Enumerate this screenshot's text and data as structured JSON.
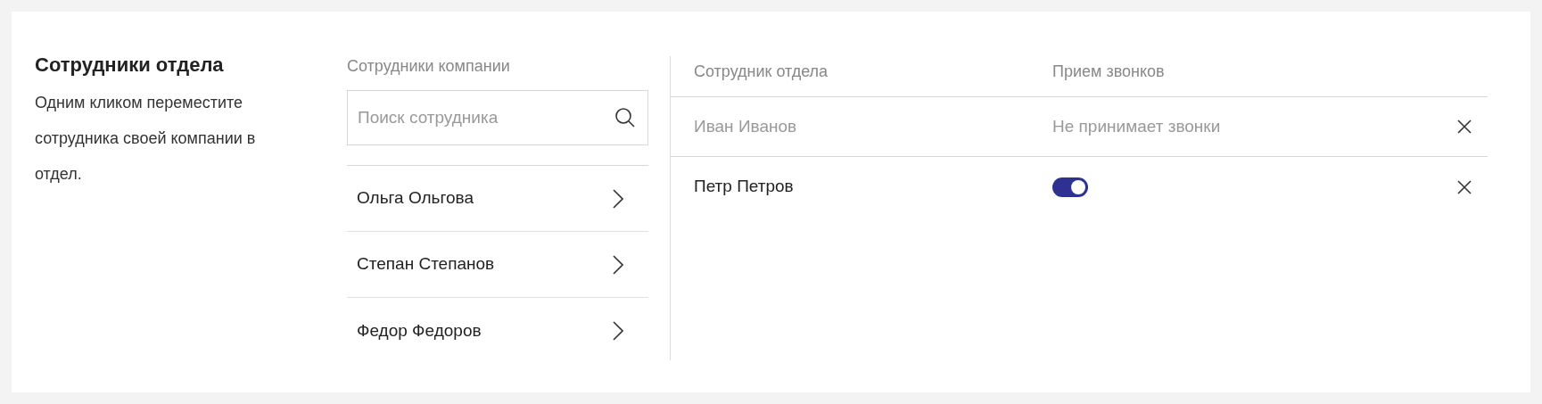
{
  "intro": {
    "title": "Сотрудники отдела",
    "description": "Одним кликом переместите сотрудника своей компании в отдел."
  },
  "company": {
    "header": "Сотрудники компании",
    "search": {
      "placeholder": "Поиск сотрудника"
    },
    "employees": [
      {
        "name": "Ольга Ольгова"
      },
      {
        "name": "Степан Степанов"
      },
      {
        "name": "Федор Федоров"
      }
    ]
  },
  "department": {
    "columns": [
      "Сотрудник отдела",
      "Прием звонков"
    ],
    "rows": [
      {
        "name": "Иван Иванов",
        "kind": "status",
        "status": "Не принимает звонки",
        "disabled": true
      },
      {
        "name": "Петр Петров",
        "kind": "toggle",
        "on": true,
        "disabled": false
      }
    ]
  }
}
